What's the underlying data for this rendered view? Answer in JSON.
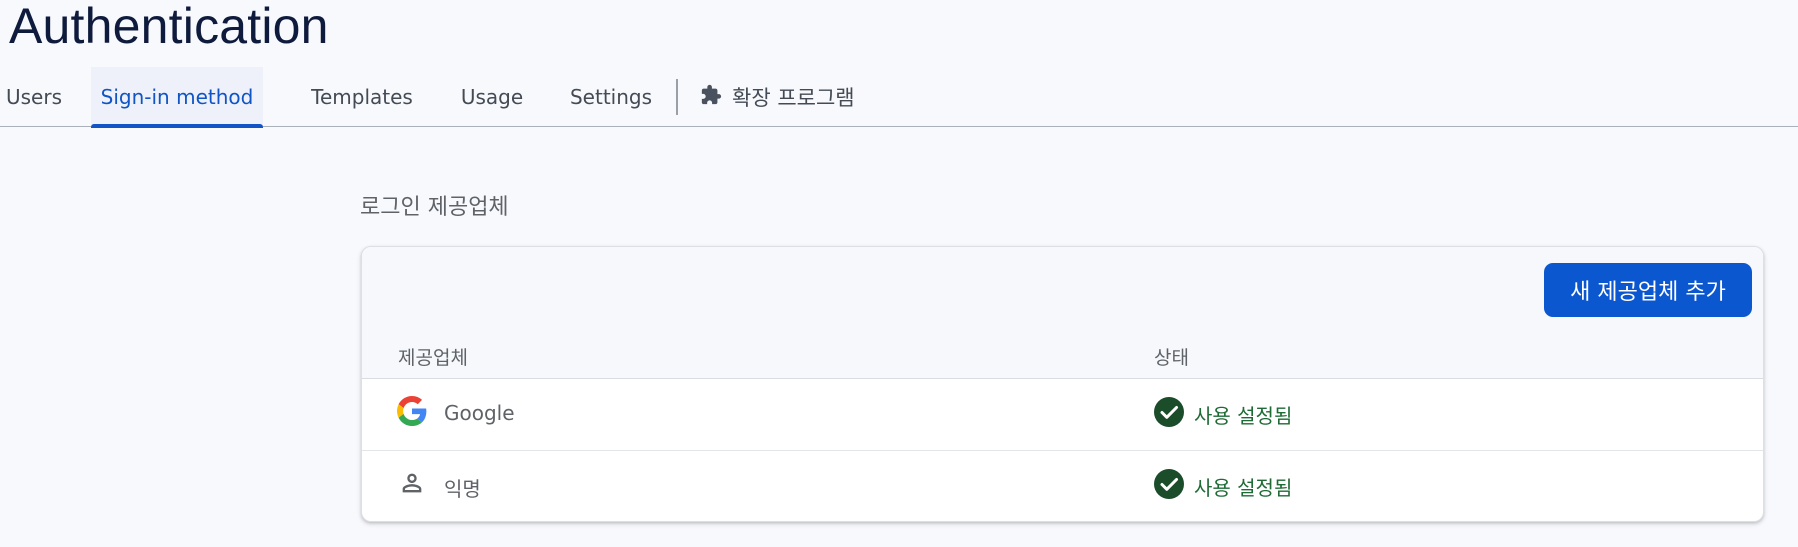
{
  "header": {
    "title": "Authentication"
  },
  "tabs": [
    {
      "label": "Users",
      "active": false
    },
    {
      "label": "Sign-in method",
      "active": true
    },
    {
      "label": "Templates",
      "active": false
    },
    {
      "label": "Usage",
      "active": false
    },
    {
      "label": "Settings",
      "active": false
    }
  ],
  "extensions_tab": {
    "label": "확장 프로그램",
    "icon": "puzzle-icon"
  },
  "providers_section": {
    "label": "로그인 제공업체",
    "add_button_label": "새 제공업체 추가",
    "columns": [
      "제공업체",
      "상태"
    ],
    "rows": [
      {
        "icon": "google-logo-icon",
        "name": "Google",
        "status_icon": "check-circle-icon",
        "status": "사용 설정됨"
      },
      {
        "icon": "person-icon",
        "name": "익명",
        "status_icon": "check-circle-icon",
        "status": "사용 설정됨"
      }
    ]
  },
  "colors": {
    "accent": "#0b57d0",
    "active_tab_text": "#1154c5",
    "enabled_green": "#1b5e2b",
    "title": "#0f1b3d"
  }
}
